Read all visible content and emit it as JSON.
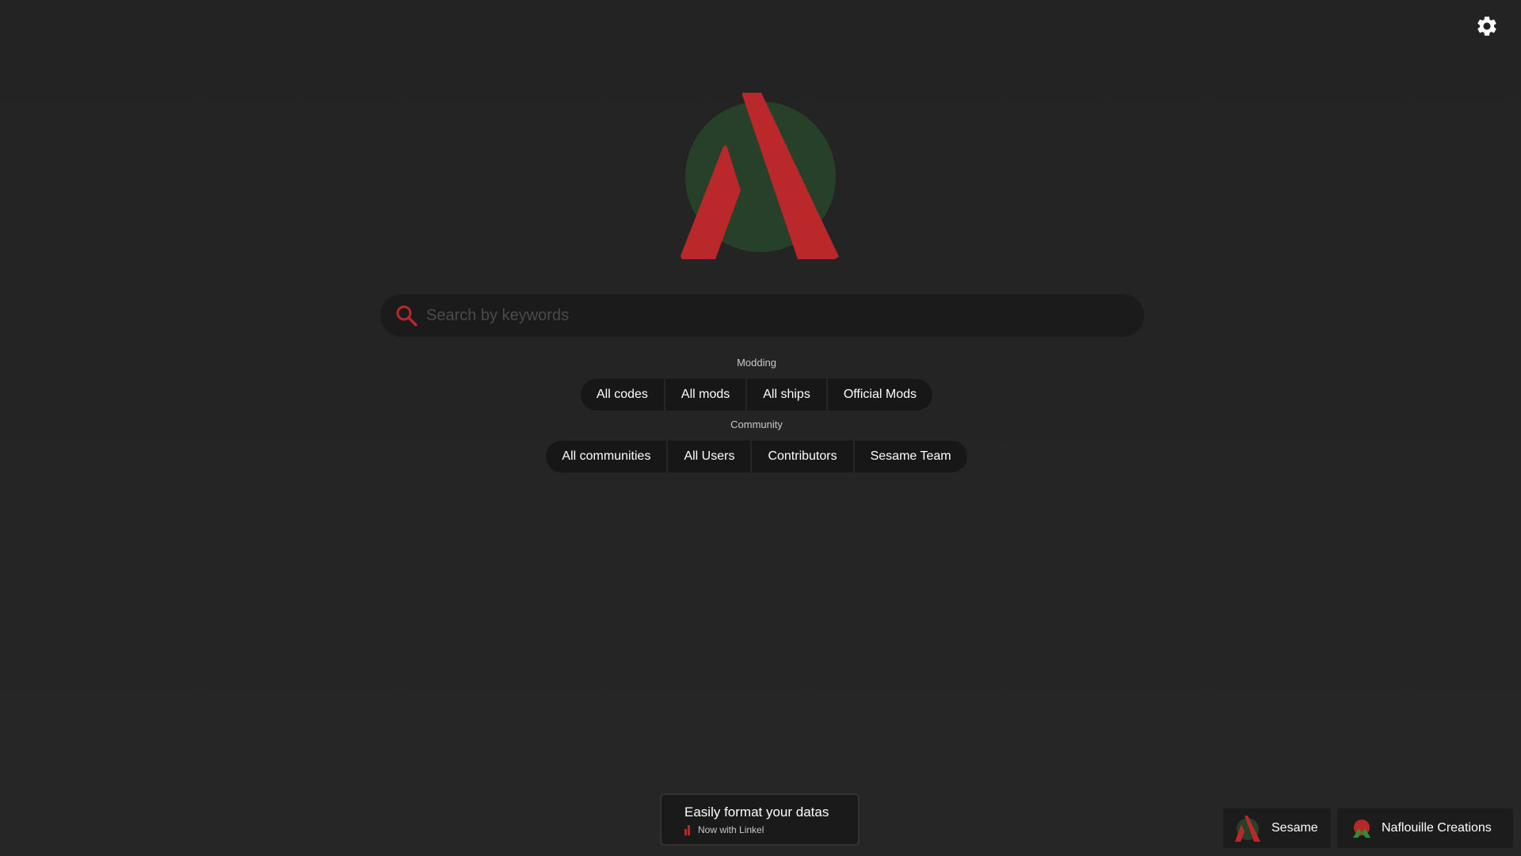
{
  "settings": {
    "icon": "gear-icon"
  },
  "search": {
    "placeholder": "Search by keywords",
    "value": "",
    "icon": "search-icon"
  },
  "modding": {
    "label": "Modding",
    "buttons": [
      "All codes",
      "All mods",
      "All ships",
      "Official Mods"
    ]
  },
  "community": {
    "label": "Community",
    "buttons": [
      "All communities",
      "All Users",
      "Contributors",
      "Sesame Team"
    ]
  },
  "promo": {
    "title": "Easily format your datas",
    "subtitle": "Now with Linkel"
  },
  "footer": {
    "sesame_label": "Sesame",
    "naflouille_label": "Naflouille Creations"
  },
  "colors": {
    "background": "#242424",
    "accent_red": "#b8272a",
    "accent_green": "#27402a",
    "button_bg": "#171717"
  }
}
